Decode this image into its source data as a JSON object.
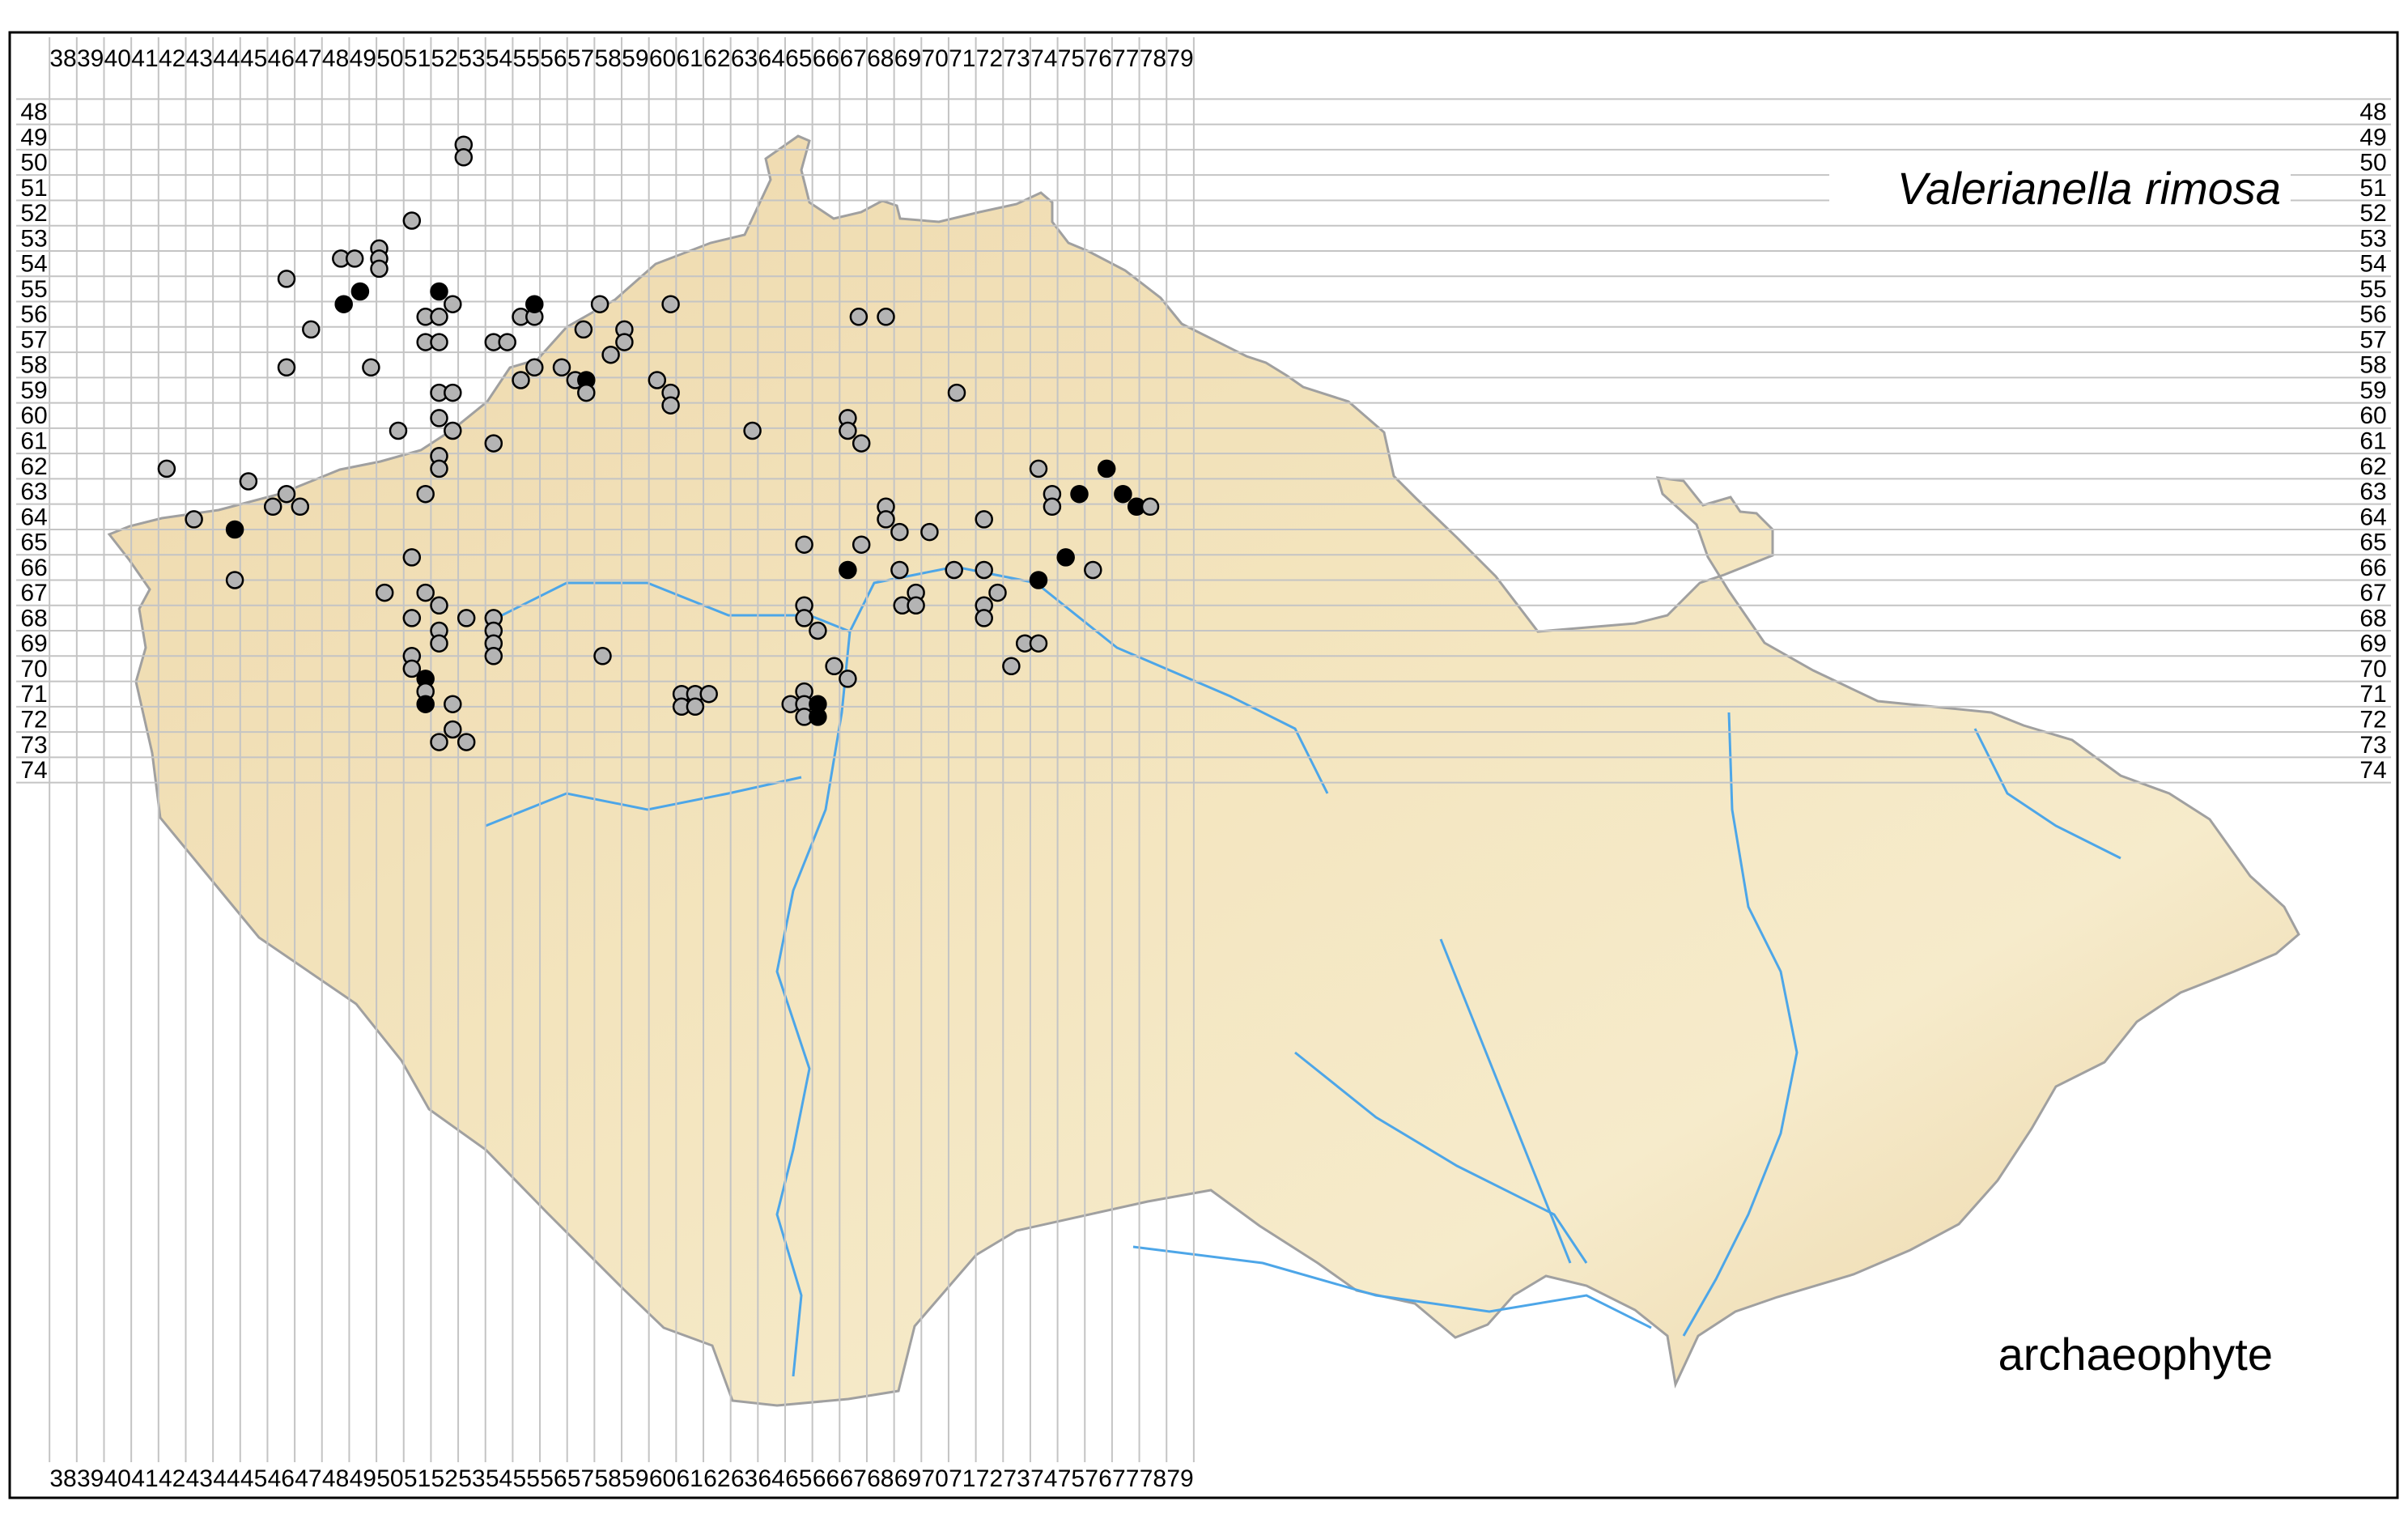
{
  "species": "Valerianella rimosa",
  "status": "archaeophyte",
  "grid": {
    "columns": [
      "38",
      "39",
      "40",
      "41",
      "42",
      "43",
      "44",
      "45",
      "46",
      "47",
      "48",
      "49",
      "50",
      "51",
      "52",
      "53",
      "54",
      "55",
      "56",
      "57",
      "58",
      "59",
      "60",
      "61",
      "62",
      "63",
      "64",
      "65",
      "66",
      "67",
      "68",
      "69",
      "70",
      "71",
      "72",
      "73",
      "74",
      "75",
      "76",
      "77",
      "78",
      "79"
    ],
    "rows": [
      "48",
      "49",
      "50",
      "51",
      "52",
      "53",
      "54",
      "55",
      "56",
      "57",
      "58",
      "59",
      "60",
      "61",
      "62",
      "63",
      "64",
      "65",
      "66",
      "67",
      "68",
      "69",
      "70",
      "71",
      "72",
      "73",
      "74"
    ]
  },
  "legend": {
    "gray": "#b4b4b4",
    "black": "#000000"
  },
  "records": [
    {
      "col": 52.7,
      "row": 49.3,
      "t": "g"
    },
    {
      "col": 52.7,
      "row": 49.8,
      "t": "g"
    },
    {
      "col": 50.8,
      "row": 52.3,
      "t": "g"
    },
    {
      "col": 48.2,
      "row": 53.8,
      "t": "g"
    },
    {
      "col": 48.7,
      "row": 53.8,
      "t": "g"
    },
    {
      "col": 49.6,
      "row": 53.4,
      "t": "g"
    },
    {
      "col": 49.6,
      "row": 53.8,
      "t": "g"
    },
    {
      "col": 49.6,
      "row": 54.2,
      "t": "g"
    },
    {
      "col": 46.2,
      "row": 54.6,
      "t": "g"
    },
    {
      "col": 48.9,
      "row": 55.1,
      "t": "b"
    },
    {
      "col": 48.3,
      "row": 55.6,
      "t": "b"
    },
    {
      "col": 51.8,
      "row": 55.1,
      "t": "b"
    },
    {
      "col": 52.3,
      "row": 55.6,
      "t": "g"
    },
    {
      "col": 51.3,
      "row": 56.1,
      "t": "g"
    },
    {
      "col": 51.8,
      "row": 56.1,
      "t": "g"
    },
    {
      "col": 47.1,
      "row": 56.6,
      "t": "g"
    },
    {
      "col": 51.3,
      "row": 57.1,
      "t": "g"
    },
    {
      "col": 51.8,
      "row": 57.1,
      "t": "g"
    },
    {
      "col": 53.8,
      "row": 57.1,
      "t": "g"
    },
    {
      "col": 54.3,
      "row": 57.1,
      "t": "g"
    },
    {
      "col": 54.8,
      "row": 56.1,
      "t": "g"
    },
    {
      "col": 55.3,
      "row": 56.1,
      "t": "g"
    },
    {
      "col": 55.3,
      "row": 55.6,
      "t": "b"
    },
    {
      "col": 57.1,
      "row": 56.6,
      "t": "g"
    },
    {
      "col": 57.7,
      "row": 55.6,
      "t": "g"
    },
    {
      "col": 58.6,
      "row": 56.6,
      "t": "g"
    },
    {
      "col": 58.6,
      "row": 57.1,
      "t": "g"
    },
    {
      "col": 58.1,
      "row": 57.6,
      "t": "g"
    },
    {
      "col": 60.3,
      "row": 55.6,
      "t": "g"
    },
    {
      "col": 46.2,
      "row": 58.1,
      "t": "g"
    },
    {
      "col": 49.3,
      "row": 58.1,
      "t": "g"
    },
    {
      "col": 55.3,
      "row": 58.1,
      "t": "g"
    },
    {
      "col": 54.8,
      "row": 58.6,
      "t": "g"
    },
    {
      "col": 56.3,
      "row": 58.1,
      "t": "g"
    },
    {
      "col": 56.8,
      "row": 58.6,
      "t": "g"
    },
    {
      "col": 57.2,
      "row": 58.6,
      "t": "b"
    },
    {
      "col": 57.2,
      "row": 59.1,
      "t": "g"
    },
    {
      "col": 59.8,
      "row": 58.6,
      "t": "g"
    },
    {
      "col": 60.3,
      "row": 59.1,
      "t": "g"
    },
    {
      "col": 60.3,
      "row": 59.6,
      "t": "g"
    },
    {
      "col": 51.8,
      "row": 59.1,
      "t": "g"
    },
    {
      "col": 52.3,
      "row": 59.1,
      "t": "g"
    },
    {
      "col": 51.8,
      "row": 60.1,
      "t": "g"
    },
    {
      "col": 52.3,
      "row": 60.6,
      "t": "g"
    },
    {
      "col": 50.3,
      "row": 60.6,
      "t": "g"
    },
    {
      "col": 53.8,
      "row": 61.1,
      "t": "g"
    },
    {
      "col": 51.8,
      "row": 61.6,
      "t": "g"
    },
    {
      "col": 51.8,
      "row": 62.1,
      "t": "g"
    },
    {
      "col": 51.3,
      "row": 63.1,
      "t": "g"
    },
    {
      "col": 41.8,
      "row": 62.1,
      "t": "g"
    },
    {
      "col": 44.8,
      "row": 62.6,
      "t": "g"
    },
    {
      "col": 46.2,
      "row": 63.1,
      "t": "g"
    },
    {
      "col": 45.7,
      "row": 63.6,
      "t": "g"
    },
    {
      "col": 46.7,
      "row": 63.6,
      "t": "g"
    },
    {
      "col": 42.8,
      "row": 64.1,
      "t": "g"
    },
    {
      "col": 44.3,
      "row": 64.5,
      "t": "b"
    },
    {
      "col": 44.3,
      "row": 66.5,
      "t": "g"
    },
    {
      "col": 50.8,
      "row": 65.6,
      "t": "g"
    },
    {
      "col": 49.8,
      "row": 67.0,
      "t": "g"
    },
    {
      "col": 51.3,
      "row": 67.0,
      "t": "g"
    },
    {
      "col": 51.8,
      "row": 67.5,
      "t": "g"
    },
    {
      "col": 50.8,
      "row": 68.0,
      "t": "g"
    },
    {
      "col": 51.8,
      "row": 68.5,
      "t": "g"
    },
    {
      "col": 51.8,
      "row": 69.0,
      "t": "g"
    },
    {
      "col": 52.8,
      "row": 68.0,
      "t": "g"
    },
    {
      "col": 53.8,
      "row": 68.0,
      "t": "g"
    },
    {
      "col": 53.8,
      "row": 68.5,
      "t": "g"
    },
    {
      "col": 53.8,
      "row": 69.0,
      "t": "g"
    },
    {
      "col": 53.8,
      "row": 69.5,
      "t": "g"
    },
    {
      "col": 50.8,
      "row": 69.5,
      "t": "g"
    },
    {
      "col": 50.8,
      "row": 70.0,
      "t": "g"
    },
    {
      "col": 51.3,
      "row": 70.4,
      "t": "b"
    },
    {
      "col": 51.3,
      "row": 70.9,
      "t": "g"
    },
    {
      "col": 51.3,
      "row": 71.4,
      "t": "b"
    },
    {
      "col": 52.3,
      "row": 71.4,
      "t": "g"
    },
    {
      "col": 52.3,
      "row": 72.4,
      "t": "g"
    },
    {
      "col": 51.8,
      "row": 72.9,
      "t": "g"
    },
    {
      "col": 52.8,
      "row": 72.9,
      "t": "g"
    },
    {
      "col": 57.8,
      "row": 69.5,
      "t": "g"
    },
    {
      "col": 60.7,
      "row": 71.0,
      "t": "g"
    },
    {
      "col": 61.2,
      "row": 71.0,
      "t": "g"
    },
    {
      "col": 61.7,
      "row": 71.0,
      "t": "g"
    },
    {
      "col": 60.7,
      "row": 71.5,
      "t": "g"
    },
    {
      "col": 61.2,
      "row": 71.5,
      "t": "g"
    },
    {
      "col": 63.3,
      "row": 60.6,
      "t": "g"
    },
    {
      "col": 67.2,
      "row": 56.1,
      "t": "g"
    },
    {
      "col": 68.2,
      "row": 56.1,
      "t": "g"
    },
    {
      "col": 70.8,
      "row": 59.1,
      "t": "g"
    },
    {
      "col": 66.8,
      "row": 60.1,
      "t": "g"
    },
    {
      "col": 66.8,
      "row": 60.6,
      "t": "g"
    },
    {
      "col": 67.3,
      "row": 61.1,
      "t": "g"
    },
    {
      "col": 68.2,
      "row": 63.6,
      "t": "g"
    },
    {
      "col": 68.2,
      "row": 64.1,
      "t": "g"
    },
    {
      "col": 68.7,
      "row": 64.6,
      "t": "g"
    },
    {
      "col": 69.8,
      "row": 64.6,
      "t": "g"
    },
    {
      "col": 65.2,
      "row": 65.1,
      "t": "g"
    },
    {
      "col": 67.3,
      "row": 65.1,
      "t": "g"
    },
    {
      "col": 66.8,
      "row": 66.1,
      "t": "b"
    },
    {
      "col": 68.7,
      "row": 66.1,
      "t": "g"
    },
    {
      "col": 70.7,
      "row": 66.1,
      "t": "g"
    },
    {
      "col": 69.3,
      "row": 67.0,
      "t": "g"
    },
    {
      "col": 68.8,
      "row": 67.5,
      "t": "g"
    },
    {
      "col": 69.3,
      "row": 67.5,
      "t": "g"
    },
    {
      "col": 65.2,
      "row": 67.5,
      "t": "g"
    },
    {
      "col": 65.2,
      "row": 68.0,
      "t": "g"
    },
    {
      "col": 65.7,
      "row": 68.5,
      "t": "g"
    },
    {
      "col": 66.3,
      "row": 69.9,
      "t": "g"
    },
    {
      "col": 66.8,
      "row": 70.4,
      "t": "g"
    },
    {
      "col": 65.2,
      "row": 70.9,
      "t": "g"
    },
    {
      "col": 64.7,
      "row": 71.4,
      "t": "g"
    },
    {
      "col": 65.2,
      "row": 71.4,
      "t": "g"
    },
    {
      "col": 65.7,
      "row": 71.4,
      "t": "b"
    },
    {
      "col": 65.2,
      "row": 71.9,
      "t": "g"
    },
    {
      "col": 65.7,
      "row": 71.9,
      "t": "b"
    },
    {
      "col": 71.8,
      "row": 64.1,
      "t": "g"
    },
    {
      "col": 71.8,
      "row": 66.1,
      "t": "g"
    },
    {
      "col": 72.3,
      "row": 67.0,
      "t": "g"
    },
    {
      "col": 71.8,
      "row": 67.5,
      "t": "g"
    },
    {
      "col": 71.8,
      "row": 68.0,
      "t": "g"
    },
    {
      "col": 73.3,
      "row": 69.0,
      "t": "g"
    },
    {
      "col": 73.8,
      "row": 69.0,
      "t": "g"
    },
    {
      "col": 72.8,
      "row": 69.9,
      "t": "g"
    },
    {
      "col": 73.8,
      "row": 62.1,
      "t": "g"
    },
    {
      "col": 74.3,
      "row": 63.1,
      "t": "g"
    },
    {
      "col": 74.3,
      "row": 63.6,
      "t": "g"
    },
    {
      "col": 75.3,
      "row": 63.1,
      "t": "b"
    },
    {
      "col": 76.3,
      "row": 62.1,
      "t": "b"
    },
    {
      "col": 76.9,
      "row": 63.1,
      "t": "b"
    },
    {
      "col": 77.4,
      "row": 63.6,
      "t": "b"
    },
    {
      "col": 77.9,
      "row": 63.6,
      "t": "g"
    },
    {
      "col": 74.8,
      "row": 65.6,
      "t": "b"
    },
    {
      "col": 73.8,
      "row": 66.5,
      "t": "b"
    },
    {
      "col": 75.8,
      "row": 66.1,
      "t": "g"
    }
  ]
}
